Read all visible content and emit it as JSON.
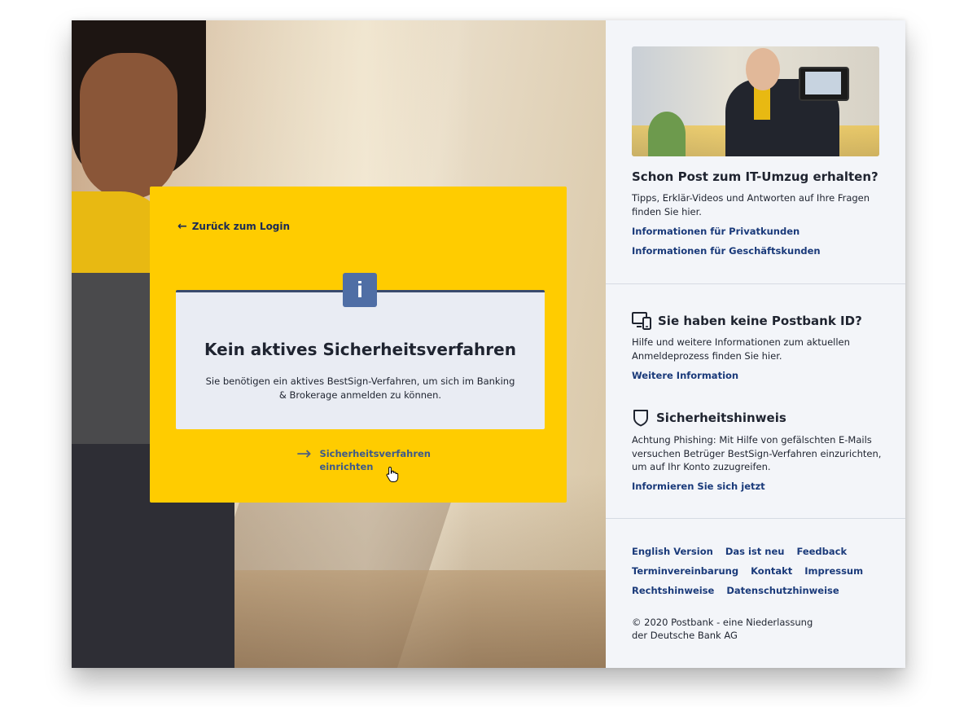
{
  "card": {
    "back_label": "Zurück zum Login",
    "info_icon": "i",
    "title": "Kein aktives Sicherheitsverfahren",
    "text": "Sie benötigen ein aktives BestSign-Verfahren, um sich im Banking & Brokerage anmelden zu können.",
    "setup_label": "Sicherheitsverfahren einrichten"
  },
  "sidebar": {
    "promo": {
      "title": "Schon Post zum IT-Umzug erhalten?",
      "text": "Tipps, Erklär-Videos und Antworten auf Ihre Fragen finden Sie hier.",
      "link_private": "Informationen für Privatkunden",
      "link_business": "Informationen für Geschäftskunden"
    },
    "no_id": {
      "title": "Sie haben keine Postbank ID?",
      "text": "Hilfe und weitere Informationen zum aktuellen Anmeldeprozess finden Sie hier.",
      "link": "Weitere Information"
    },
    "security": {
      "title": "Sicherheitshinweis",
      "text": "Achtung Phishing: Mit Hilfe von gefälschten E-Mails versuchen Betrüger BestSign-Verfahren einzurichten, um auf Ihr Konto zuzugreifen.",
      "link": "Informieren Sie sich jetzt"
    }
  },
  "footer": {
    "row1": [
      "English Version",
      "Das ist neu",
      "Feedback"
    ],
    "row2": [
      "Terminvereinbarung",
      "Kontakt",
      "Impressum"
    ],
    "row3": [
      "Rechtshinweise",
      "Datenschutzhinweise"
    ],
    "copyright": "© 2020 Postbank - eine Niederlassung der Deutsche Bank AG"
  },
  "colors": {
    "brand_yellow": "#ffcc00",
    "link_blue": "#1a3a7a",
    "info_blue": "#4f6ea5"
  }
}
